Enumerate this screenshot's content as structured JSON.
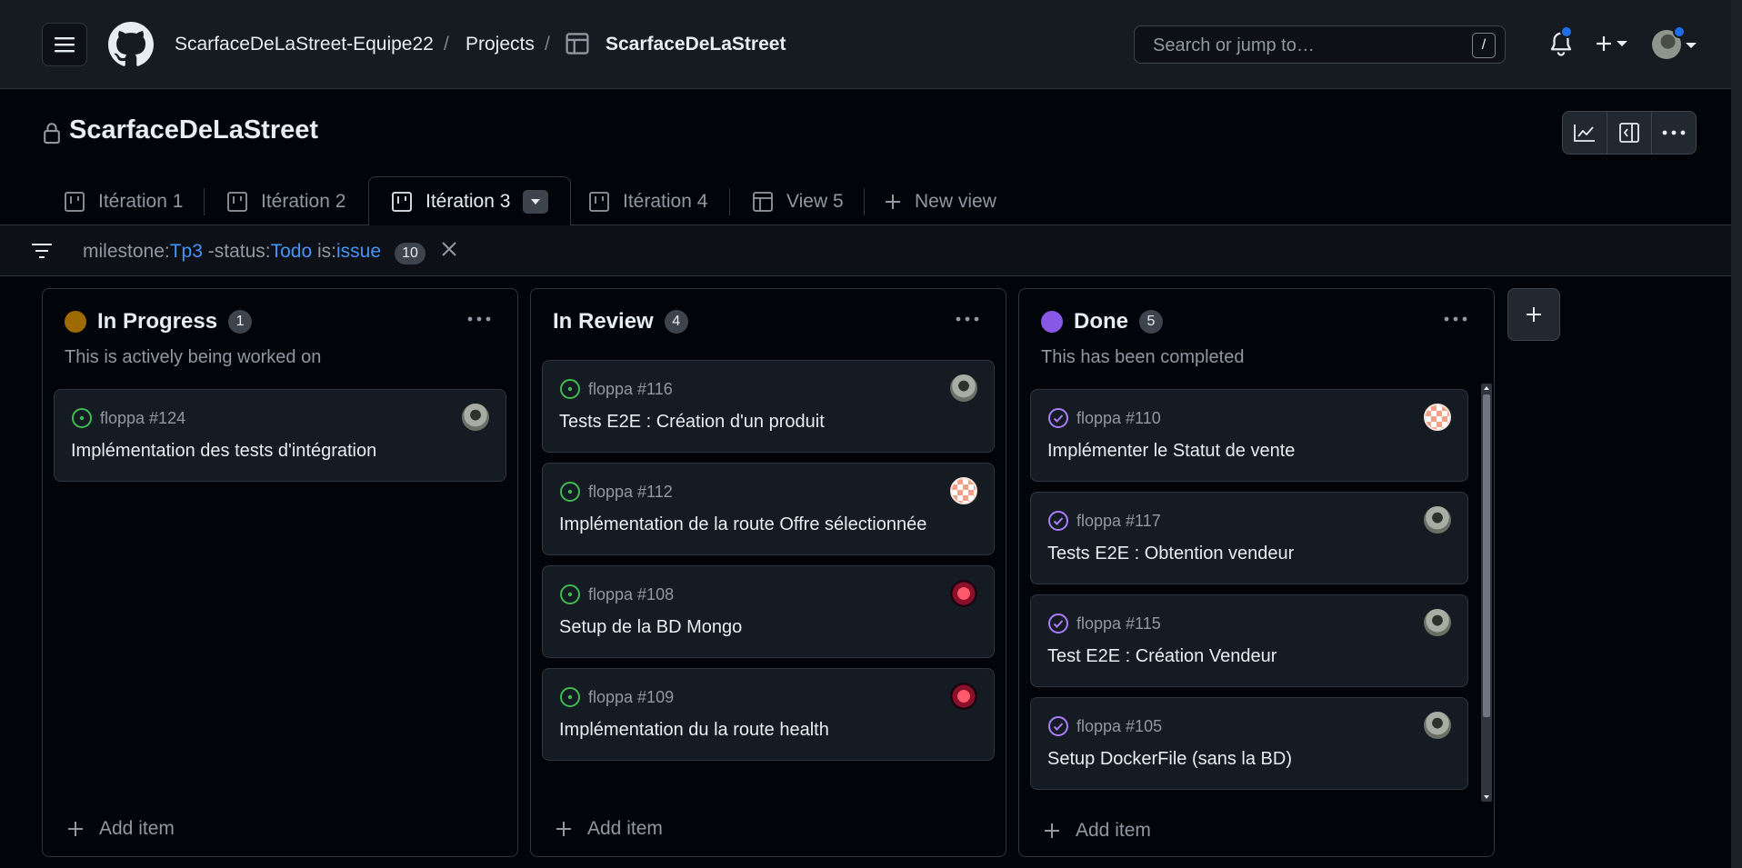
{
  "header": {
    "org": "ScarfaceDeLaStreet-Equipe22",
    "sep1": "/",
    "projects": "Projects",
    "sep2": "/",
    "project": "ScarfaceDeLaStreet",
    "search_placeholder": "Search or jump to…",
    "search_shortcut": "/"
  },
  "project": {
    "title": "ScarfaceDeLaStreet"
  },
  "tabs": [
    {
      "label": "Itération 1",
      "icon": "board-icon"
    },
    {
      "label": "Itération 2",
      "icon": "board-icon"
    },
    {
      "label": "Itération 3",
      "icon": "board-icon",
      "active": true
    },
    {
      "label": "Itération 4",
      "icon": "board-icon"
    },
    {
      "label": "View 5",
      "icon": "table-icon"
    },
    {
      "label": "New view",
      "icon": "plus-icon"
    }
  ],
  "filter": {
    "k1": "milestone:",
    "v1": "Tp3",
    "k2": " -status:",
    "v2": "Todo",
    "k3": " is:",
    "v3": "issue",
    "count": "10"
  },
  "columns": [
    {
      "title": "In Progress",
      "count": "1",
      "color": "#9e6a03",
      "description": "This is actively being worked on",
      "add_label": "Add item",
      "cards": [
        {
          "ref": "floppa #124",
          "title": "Implémentation des tests d'intégration",
          "state": "open",
          "avatar": "photo"
        }
      ]
    },
    {
      "title": "In Review",
      "count": "4",
      "color": "",
      "description": "",
      "add_label": "Add item",
      "cards": [
        {
          "ref": "floppa #116",
          "title": "Tests E2E : Création d'un produit",
          "state": "open",
          "avatar": "photo"
        },
        {
          "ref": "floppa #112",
          "title": "Implémentation de la route Offre sélectionnée",
          "state": "open",
          "avatar": "pink"
        },
        {
          "ref": "floppa #108",
          "title": "Setup de la BD Mongo",
          "state": "open",
          "avatar": "red"
        },
        {
          "ref": "floppa #109",
          "title": "Implémentation du la route health",
          "state": "open",
          "avatar": "red"
        }
      ]
    },
    {
      "title": "Done",
      "count": "5",
      "color": "#8957e5",
      "description": "This has been completed",
      "add_label": "Add item",
      "cards": [
        {
          "ref": "floppa #110",
          "title": "Implémenter le Statut de vente",
          "state": "closed",
          "avatar": "pink"
        },
        {
          "ref": "floppa #117",
          "title": "Tests E2E : Obtention vendeur",
          "state": "closed",
          "avatar": "photo"
        },
        {
          "ref": "floppa #115",
          "title": "Test E2E : Création Vendeur",
          "state": "closed",
          "avatar": "photo"
        },
        {
          "ref": "floppa #105",
          "title": "Setup DockerFile (sans la BD)",
          "state": "closed",
          "avatar": "photo"
        }
      ]
    }
  ],
  "colors": {
    "open": "#3fb950",
    "closed": "#ab7df8",
    "link": "#4493f8"
  }
}
